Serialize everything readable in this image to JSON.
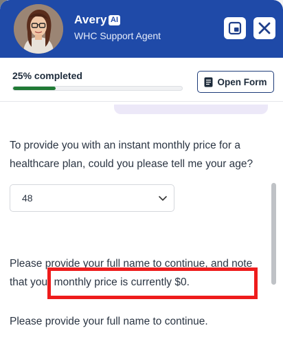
{
  "header": {
    "agent_name": "Avery",
    "ai_badge": "AI",
    "agent_role": "WHC Support Agent",
    "colors": {
      "header_bg": "#1f4aa8"
    },
    "icons": {
      "minimize": "picture-in-picture-icon",
      "close": "close-icon"
    }
  },
  "progress": {
    "label": "25% completed",
    "fraction": 0.25,
    "fill_color": "#1f7a34",
    "open_form_label": "Open Form",
    "open_form_icon": "form-document-icon"
  },
  "chat": {
    "messages": [
      "To provide you with an instant monthly price for a healthcare plan, could you please tell me your age?",
      "Please provide your full name to continue, and note that your monthly price is currently $0.",
      "Please provide your full name to continue."
    ],
    "age_select": {
      "selected": "48",
      "icon": "chevron-down-icon"
    },
    "highlight_color": "#ee1c1c"
  }
}
